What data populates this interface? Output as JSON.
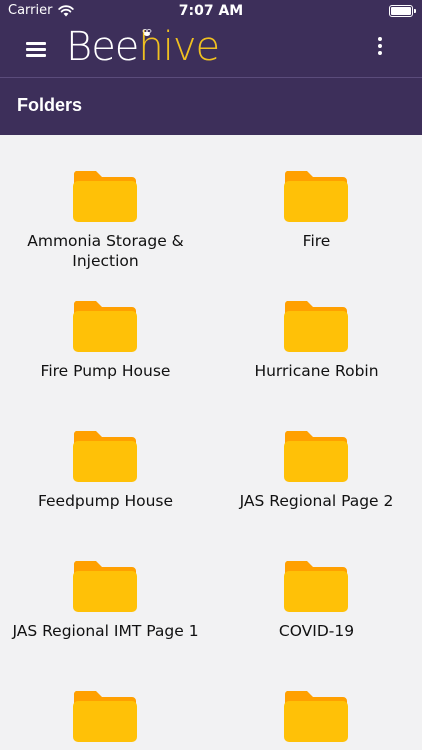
{
  "status_bar": {
    "carrier": "Carrier",
    "time": "7:07 AM",
    "wifi_icon": "wifi-icon",
    "battery_icon": "battery-icon"
  },
  "app_bar": {
    "logo_part1": "Bee",
    "logo_part2": "hive",
    "menu_icon": "hamburger-menu-icon",
    "more_icon": "vertical-dots-icon"
  },
  "section": {
    "title": "Folders"
  },
  "colors": {
    "header_bg": "#3d2f5a",
    "logo_accent": "#f0c020",
    "folder_front": "#ffc107",
    "folder_back": "#ffa000",
    "page_bg": "#f2f2f3"
  },
  "folders": [
    {
      "label": "Ammonia Storage & Injection",
      "icon": "folder-icon"
    },
    {
      "label": "Fire",
      "icon": "folder-icon"
    },
    {
      "label": "Fire Pump House",
      "icon": "folder-icon"
    },
    {
      "label": "Hurricane Robin",
      "icon": "folder-icon"
    },
    {
      "label": "Feedpump House",
      "icon": "folder-icon"
    },
    {
      "label": "JAS Regional Page 2",
      "icon": "folder-icon"
    },
    {
      "label": "JAS Regional IMT Page 1",
      "icon": "folder-icon"
    },
    {
      "label": "COVID-19",
      "icon": "folder-icon"
    },
    {
      "label": "",
      "icon": "folder-icon"
    },
    {
      "label": "",
      "icon": "folder-icon"
    }
  ]
}
